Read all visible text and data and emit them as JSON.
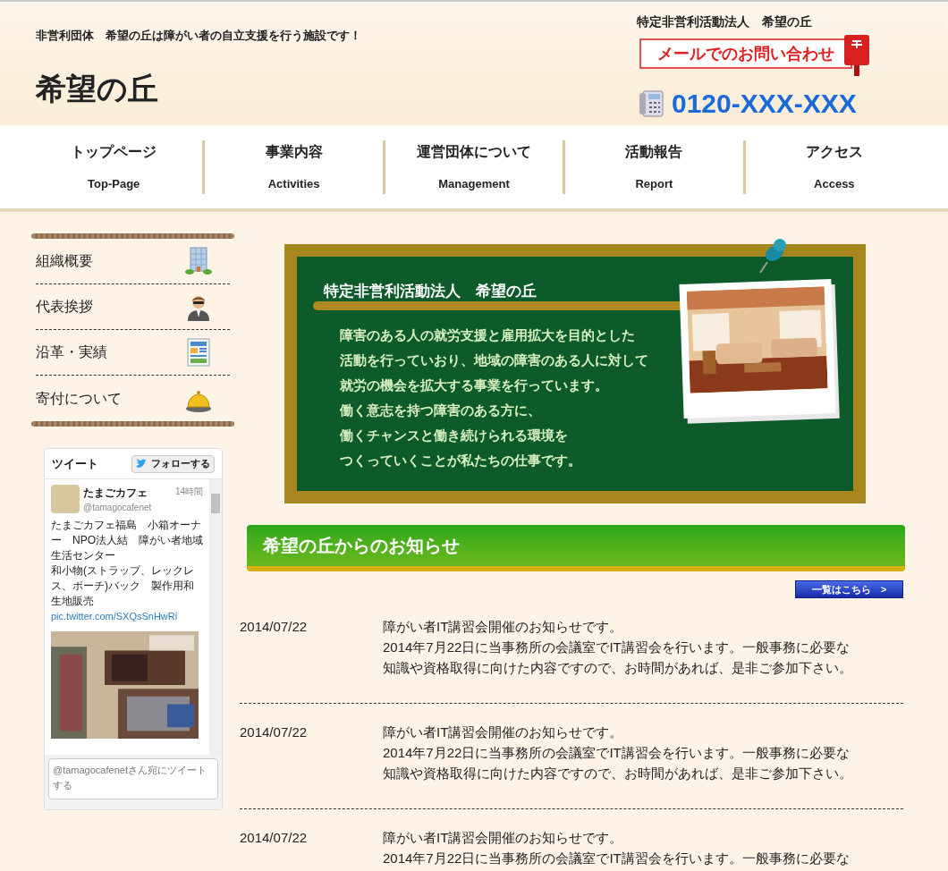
{
  "header": {
    "tagline": "非営利団体　希望の丘は障がい者の自立支援を行う施設です！",
    "site_title": "希望の丘",
    "org_name": "特定非営利活動法人　希望の丘",
    "contact_button": "メールでのお問い合わせ",
    "phone": "0120-XXX-XXX"
  },
  "nav": [
    {
      "label": "トップページ",
      "sublabel": "Top-Page"
    },
    {
      "label": "事業内容",
      "sublabel": "Activities"
    },
    {
      "label": "運営団体について",
      "sublabel": "Management"
    },
    {
      "label": "活動報告",
      "sublabel": "Report"
    },
    {
      "label": "アクセス",
      "sublabel": "Access"
    }
  ],
  "sidebar_menu": [
    {
      "label": "組織概要"
    },
    {
      "label": "代表挨拶"
    },
    {
      "label": "沿革・実績"
    },
    {
      "label": "寄付について"
    }
  ],
  "twitter_widget": {
    "title": "ツイート",
    "follow_button": "フォローする",
    "tweet": {
      "name": "たまごカフェ",
      "handle": "@tamagocafenet",
      "time": "14時間",
      "lines": [
        "たまごカフェ福島　小箱オーナー　NPO法人結　障がい者地域生活センター",
        "和小物(ストラップ、レックレス、ポーチ)バック　製作用和生地販売"
      ],
      "link": "pic.twitter.com/SXQsSnHwRi"
    },
    "reply_placeholder": "@tamagocafenetさん宛にツイートする"
  },
  "board": {
    "title": "特定非営利活動法人　希望の丘",
    "lines": [
      "障害のある人の就労支援と雇用拡大を目的とした",
      "活動を行っていおり、地域の障害のある人に対して",
      "就労の機会を拡大する事業を行っています。",
      "働く意志を持つ障害のある方に、",
      "働くチャンスと働き続けられる環境を",
      "つくっていくことが私たちの仕事です。"
    ]
  },
  "news": {
    "heading": "希望の丘からのお知らせ",
    "list_button": "一覧はこちら　>",
    "items": [
      {
        "date": "2014/07/22",
        "lines": [
          "障がい者IT講習会開催のお知らせです。",
          "2014年7月22日に当事務所の会議室でIT講習会を行います。一般事務に必要な",
          "知識や資格取得に向けた内容ですので、お時間があれば、是非ご参加下さい。"
        ]
      },
      {
        "date": "2014/07/22",
        "lines": [
          "障がい者IT講習会開催のお知らせです。",
          "2014年7月22日に当事務所の会議室でIT講習会を行います。一般事務に必要な",
          "知識や資格取得に向けた内容ですので、お時間があれば、是非ご参加下さい。"
        ]
      },
      {
        "date": "2014/07/22",
        "lines": [
          "障がい者IT講習会開催のお知らせです。",
          "2014年7月22日に当事務所の会議室でIT講習会を行います。一般事務に必要な"
        ]
      }
    ]
  }
}
